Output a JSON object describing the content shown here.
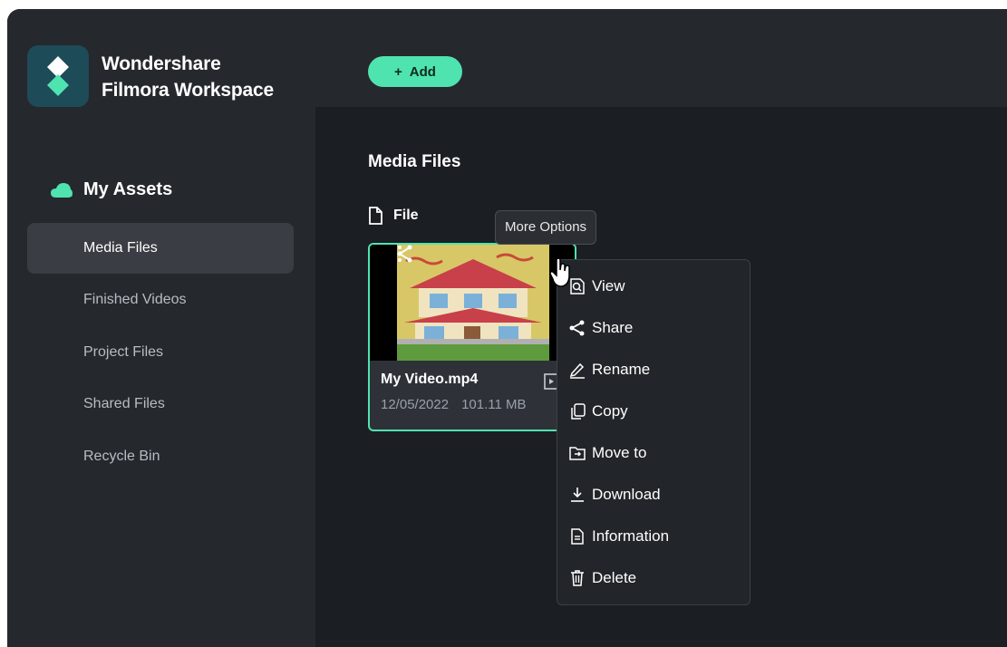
{
  "app": {
    "name_line1": "Wondershare",
    "name_line2": "Filmora Workspace"
  },
  "sidebar": {
    "section_label": "My Assets",
    "items": [
      {
        "label": "Media Files",
        "active": true
      },
      {
        "label": "Finished Videos",
        "active": false
      },
      {
        "label": "Project Files",
        "active": false
      },
      {
        "label": "Shared Files",
        "active": false
      },
      {
        "label": "Recycle Bin",
        "active": false
      }
    ]
  },
  "toolbar": {
    "add_label": "Add"
  },
  "main": {
    "title": "Media Files",
    "file_label": "File"
  },
  "card": {
    "name": "My Video.mp4",
    "date": "12/05/2022",
    "size": "101.11 MB"
  },
  "tooltip": {
    "text": "More Options"
  },
  "context_menu": {
    "items": [
      {
        "label": "View",
        "icon": "view-icon"
      },
      {
        "label": "Share",
        "icon": "share-icon"
      },
      {
        "label": "Rename",
        "icon": "rename-icon"
      },
      {
        "label": "Copy",
        "icon": "copy-icon"
      },
      {
        "label": "Move to",
        "icon": "move-to-icon"
      },
      {
        "label": "Download",
        "icon": "download-icon"
      },
      {
        "label": "Information",
        "icon": "information-icon"
      },
      {
        "label": "Delete",
        "icon": "delete-icon"
      }
    ]
  },
  "colors": {
    "accent": "#4fe3b0",
    "background": "#1b1e23",
    "sidebar": "#25282d"
  }
}
